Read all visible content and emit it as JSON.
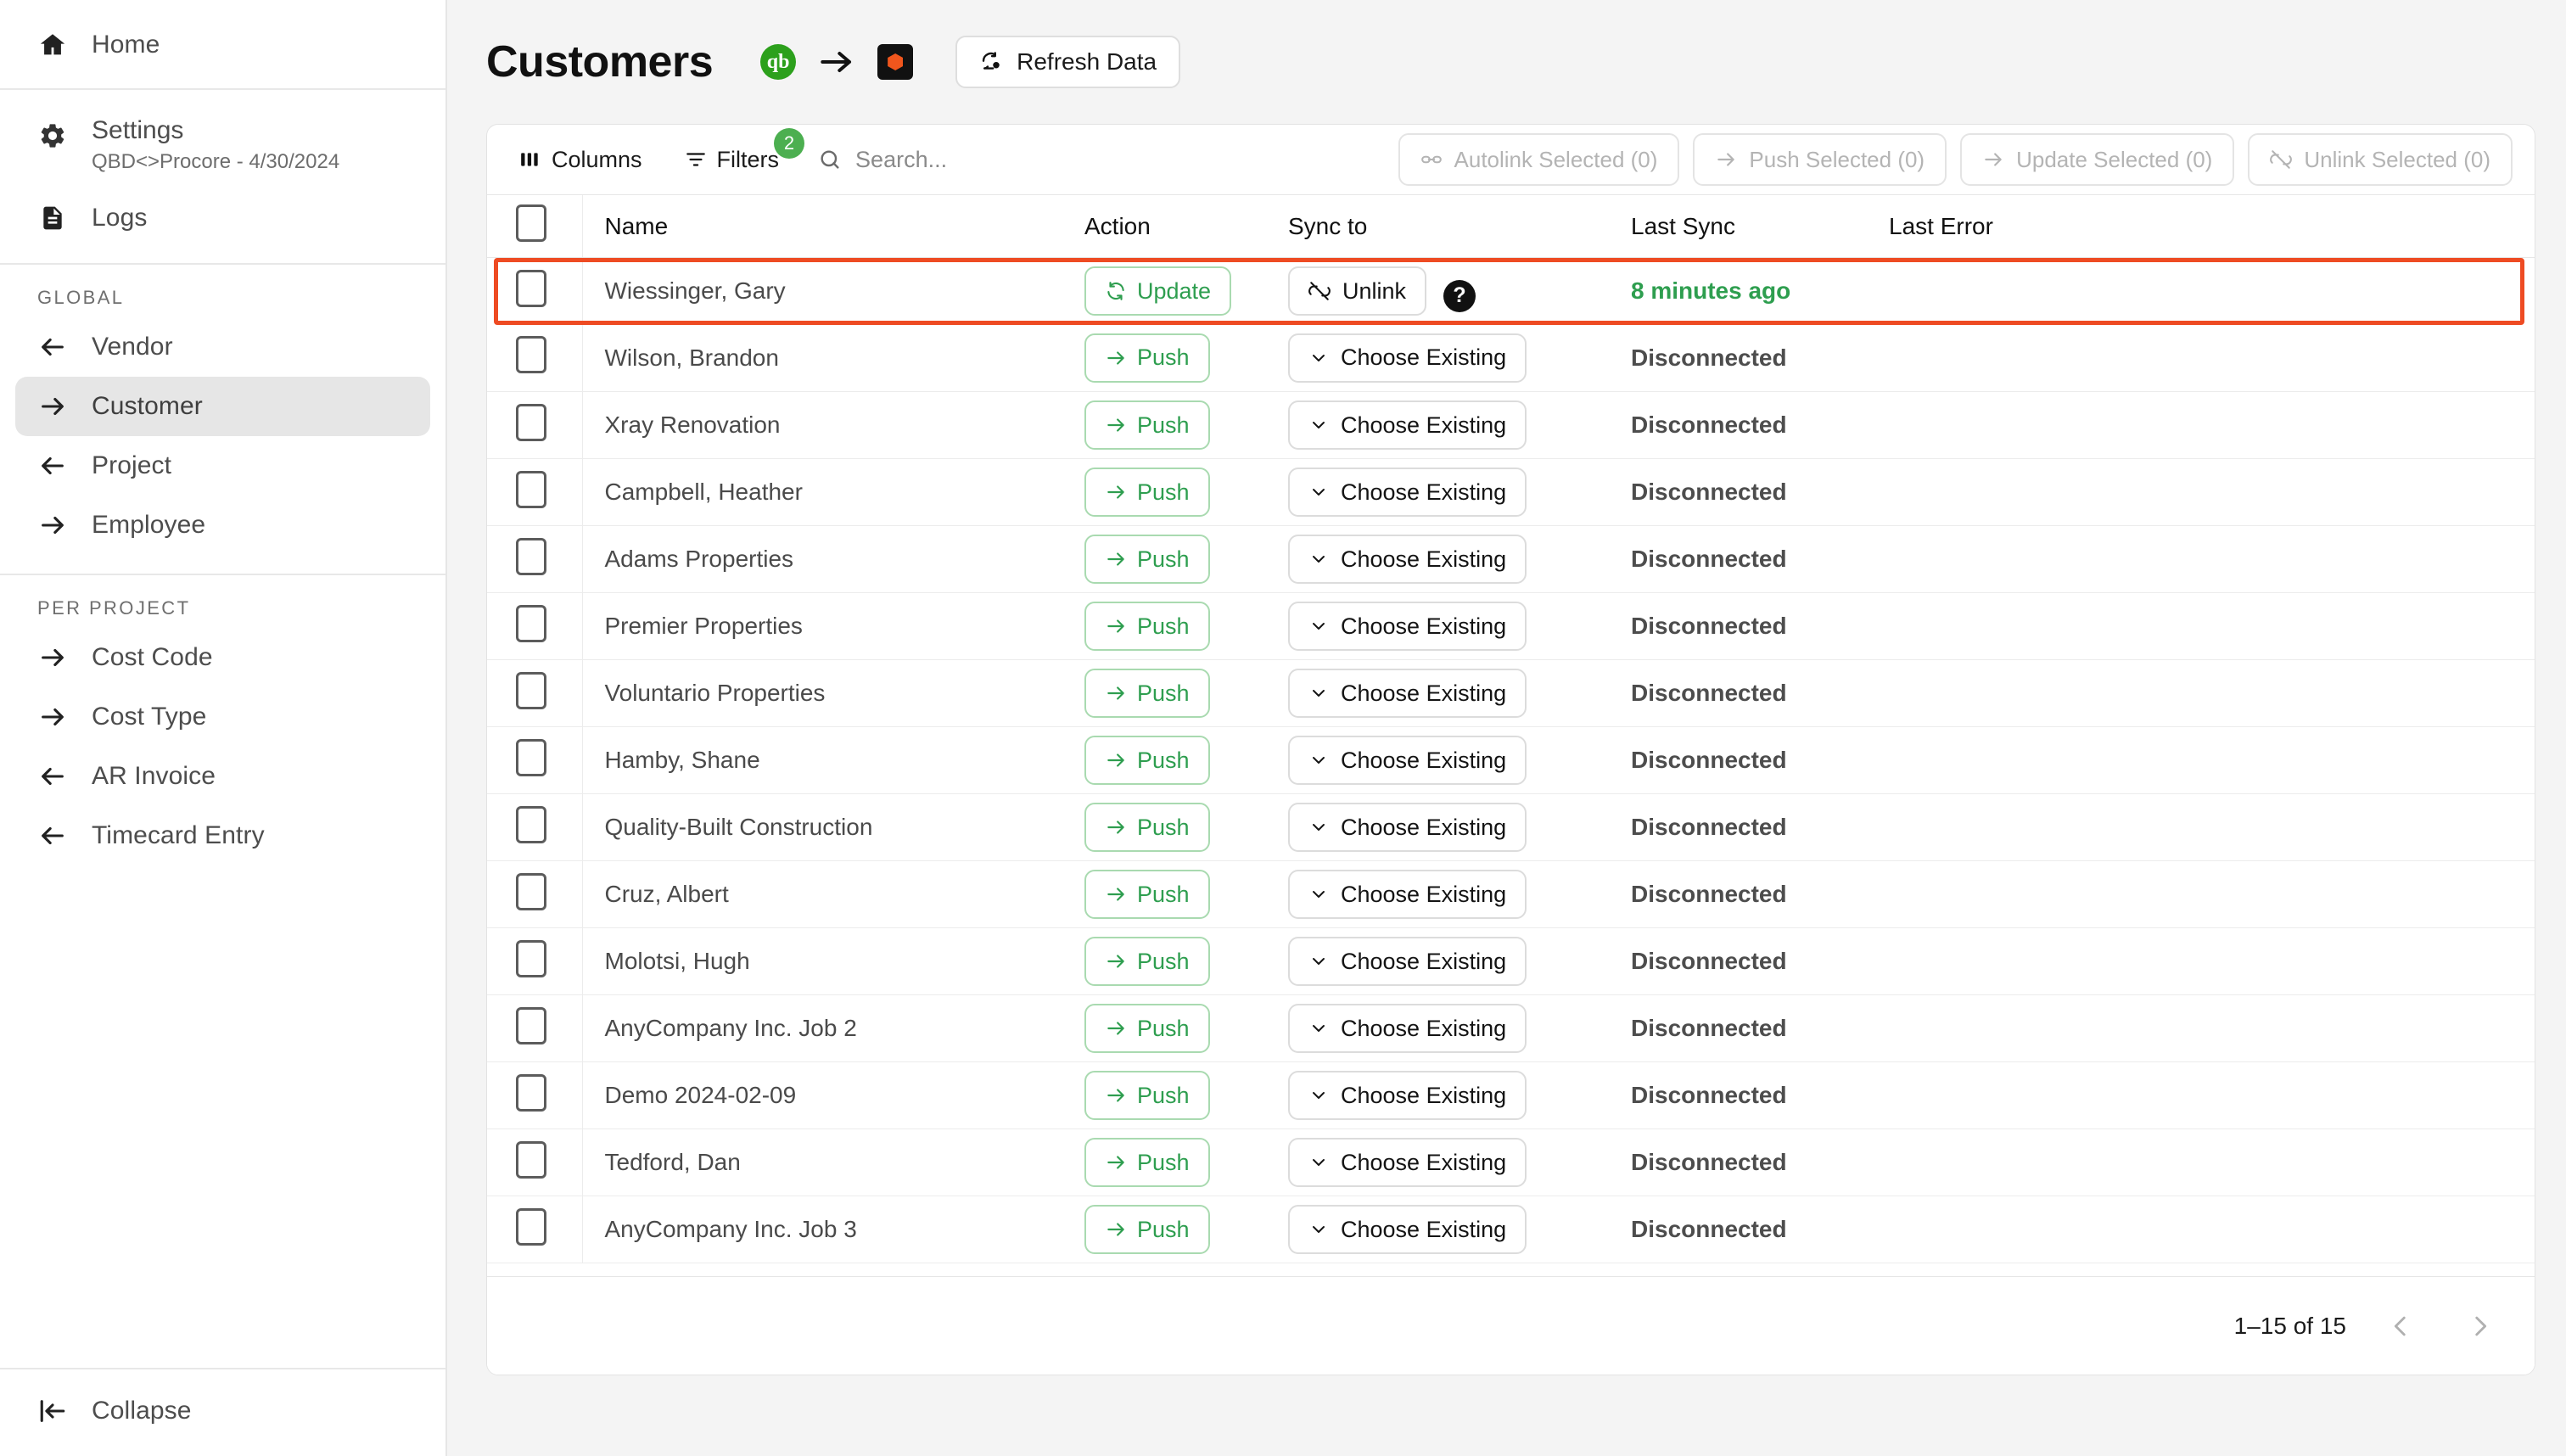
{
  "sidebar": {
    "top_items": [
      {
        "label": "Home",
        "icon": "home-icon"
      }
    ],
    "settings": {
      "label": "Settings",
      "sublabel": "QBD<>Procore - 4/30/2024",
      "icon": "gear-icon"
    },
    "logs": {
      "label": "Logs",
      "icon": "document-icon"
    },
    "groups": [
      {
        "title": "GLOBAL",
        "items": [
          {
            "label": "Vendor",
            "icon": "arrow-left-icon",
            "active": false
          },
          {
            "label": "Customer",
            "icon": "arrow-right-icon",
            "active": true
          },
          {
            "label": "Project",
            "icon": "arrow-left-icon",
            "active": false
          },
          {
            "label": "Employee",
            "icon": "arrow-right-icon",
            "active": false
          }
        ]
      },
      {
        "title": "PER PROJECT",
        "items": [
          {
            "label": "Cost Code",
            "icon": "arrow-right-icon",
            "active": false
          },
          {
            "label": "Cost Type",
            "icon": "arrow-right-icon",
            "active": false
          },
          {
            "label": "AR Invoice",
            "icon": "arrow-left-icon",
            "active": false
          },
          {
            "label": "Timecard Entry",
            "icon": "arrow-left-icon",
            "active": false
          }
        ]
      }
    ],
    "collapse": {
      "label": "Collapse",
      "icon": "collapse-left-icon"
    }
  },
  "header": {
    "title": "Customers",
    "source_logo": "quickbooks-logo",
    "source_logo_text": "qb",
    "arrow": "→",
    "target_logo": "procore-logo",
    "refresh_label": "Refresh Data",
    "refresh_icon": "refresh-data-icon"
  },
  "toolbar": {
    "columns_label": "Columns",
    "columns_icon": "columns-icon",
    "filters_label": "Filters",
    "filters_icon": "filter-icon",
    "filters_badge": "2",
    "search_placeholder": "Search...",
    "search_value": "",
    "search_icon": "search-icon",
    "actions": [
      {
        "label": "Autolink Selected (0)",
        "icon": "link-icon",
        "disabled": true
      },
      {
        "label": "Push Selected (0)",
        "icon": "arrow-right-icon",
        "disabled": true
      },
      {
        "label": "Update Selected (0)",
        "icon": "arrow-right-icon",
        "disabled": true
      },
      {
        "label": "Unlink Selected (0)",
        "icon": "unlink-icon",
        "disabled": true
      }
    ]
  },
  "table": {
    "columns": [
      "",
      "Name",
      "Action",
      "Sync to",
      "Last Sync",
      "Last Error"
    ],
    "help_icon": "help-icon",
    "rows": [
      {
        "name": "Wiessinger, Gary",
        "action_label": "Update",
        "action_kind": "update",
        "action_icon": "sync-icon",
        "sync_label": "Unlink",
        "sync_kind": "unlink",
        "sync_icon": "unlink-icon",
        "has_help": true,
        "last_sync": "8 minutes ago",
        "last_sync_state": "synced",
        "last_error": "",
        "highlighted": true
      },
      {
        "name": "Wilson, Brandon",
        "action_label": "Push",
        "action_kind": "push",
        "action_icon": "arrow-right-icon",
        "sync_label": "Choose Existing",
        "sync_kind": "choose",
        "sync_icon": "chevron-down-icon",
        "has_help": false,
        "last_sync": "Disconnected",
        "last_sync_state": "disconnected",
        "last_error": "",
        "highlighted": false
      },
      {
        "name": "Xray Renovation",
        "action_label": "Push",
        "action_kind": "push",
        "action_icon": "arrow-right-icon",
        "sync_label": "Choose Existing",
        "sync_kind": "choose",
        "sync_icon": "chevron-down-icon",
        "has_help": false,
        "last_sync": "Disconnected",
        "last_sync_state": "disconnected",
        "last_error": "",
        "highlighted": false
      },
      {
        "name": "Campbell, Heather",
        "action_label": "Push",
        "action_kind": "push",
        "action_icon": "arrow-right-icon",
        "sync_label": "Choose Existing",
        "sync_kind": "choose",
        "sync_icon": "chevron-down-icon",
        "has_help": false,
        "last_sync": "Disconnected",
        "last_sync_state": "disconnected",
        "last_error": "",
        "highlighted": false
      },
      {
        "name": "Adams Properties",
        "action_label": "Push",
        "action_kind": "push",
        "action_icon": "arrow-right-icon",
        "sync_label": "Choose Existing",
        "sync_kind": "choose",
        "sync_icon": "chevron-down-icon",
        "has_help": false,
        "last_sync": "Disconnected",
        "last_sync_state": "disconnected",
        "last_error": "",
        "highlighted": false
      },
      {
        "name": "Premier Properties",
        "action_label": "Push",
        "action_kind": "push",
        "action_icon": "arrow-right-icon",
        "sync_label": "Choose Existing",
        "sync_kind": "choose",
        "sync_icon": "chevron-down-icon",
        "has_help": false,
        "last_sync": "Disconnected",
        "last_sync_state": "disconnected",
        "last_error": "",
        "highlighted": false
      },
      {
        "name": "Voluntario Properties",
        "action_label": "Push",
        "action_kind": "push",
        "action_icon": "arrow-right-icon",
        "sync_label": "Choose Existing",
        "sync_kind": "choose",
        "sync_icon": "chevron-down-icon",
        "has_help": false,
        "last_sync": "Disconnected",
        "last_sync_state": "disconnected",
        "last_error": "",
        "highlighted": false
      },
      {
        "name": "Hamby, Shane",
        "action_label": "Push",
        "action_kind": "push",
        "action_icon": "arrow-right-icon",
        "sync_label": "Choose Existing",
        "sync_kind": "choose",
        "sync_icon": "chevron-down-icon",
        "has_help": false,
        "last_sync": "Disconnected",
        "last_sync_state": "disconnected",
        "last_error": "",
        "highlighted": false
      },
      {
        "name": "Quality-Built Construction",
        "action_label": "Push",
        "action_kind": "push",
        "action_icon": "arrow-right-icon",
        "sync_label": "Choose Existing",
        "sync_kind": "choose",
        "sync_icon": "chevron-down-icon",
        "has_help": false,
        "last_sync": "Disconnected",
        "last_sync_state": "disconnected",
        "last_error": "",
        "highlighted": false
      },
      {
        "name": "Cruz, Albert",
        "action_label": "Push",
        "action_kind": "push",
        "action_icon": "arrow-right-icon",
        "sync_label": "Choose Existing",
        "sync_kind": "choose",
        "sync_icon": "chevron-down-icon",
        "has_help": false,
        "last_sync": "Disconnected",
        "last_sync_state": "disconnected",
        "last_error": "",
        "highlighted": false
      },
      {
        "name": "Molotsi, Hugh",
        "action_label": "Push",
        "action_kind": "push",
        "action_icon": "arrow-right-icon",
        "sync_label": "Choose Existing",
        "sync_kind": "choose",
        "sync_icon": "chevron-down-icon",
        "has_help": false,
        "last_sync": "Disconnected",
        "last_sync_state": "disconnected",
        "last_error": "",
        "highlighted": false
      },
      {
        "name": "AnyCompany Inc. Job 2",
        "action_label": "Push",
        "action_kind": "push",
        "action_icon": "arrow-right-icon",
        "sync_label": "Choose Existing",
        "sync_kind": "choose",
        "sync_icon": "chevron-down-icon",
        "has_help": false,
        "last_sync": "Disconnected",
        "last_sync_state": "disconnected",
        "last_error": "",
        "highlighted": false
      },
      {
        "name": "Demo 2024-02-09",
        "action_label": "Push",
        "action_kind": "push",
        "action_icon": "arrow-right-icon",
        "sync_label": "Choose Existing",
        "sync_kind": "choose",
        "sync_icon": "chevron-down-icon",
        "has_help": false,
        "last_sync": "Disconnected",
        "last_sync_state": "disconnected",
        "last_error": "",
        "highlighted": false
      },
      {
        "name": "Tedford, Dan",
        "action_label": "Push",
        "action_kind": "push",
        "action_icon": "arrow-right-icon",
        "sync_label": "Choose Existing",
        "sync_kind": "choose",
        "sync_icon": "chevron-down-icon",
        "has_help": false,
        "last_sync": "Disconnected",
        "last_sync_state": "disconnected",
        "last_error": "",
        "highlighted": false
      },
      {
        "name": "AnyCompany Inc. Job 3",
        "action_label": "Push",
        "action_kind": "push",
        "action_icon": "arrow-right-icon",
        "sync_label": "Choose Existing",
        "sync_kind": "choose",
        "sync_icon": "chevron-down-icon",
        "has_help": false,
        "last_sync": "Disconnected",
        "last_sync_state": "disconnected",
        "last_error": "",
        "highlighted": false
      }
    ]
  },
  "footer": {
    "page_info": "1–15 of 15",
    "prev_icon": "chevron-left-icon",
    "next_icon": "chevron-right-icon"
  },
  "colors": {
    "accent_green": "#2E9E4F",
    "badge_green": "#4CAF50",
    "highlight_red": "#EE4B23",
    "qb_green": "#2CA01C",
    "procore_orange": "#F0561D"
  }
}
